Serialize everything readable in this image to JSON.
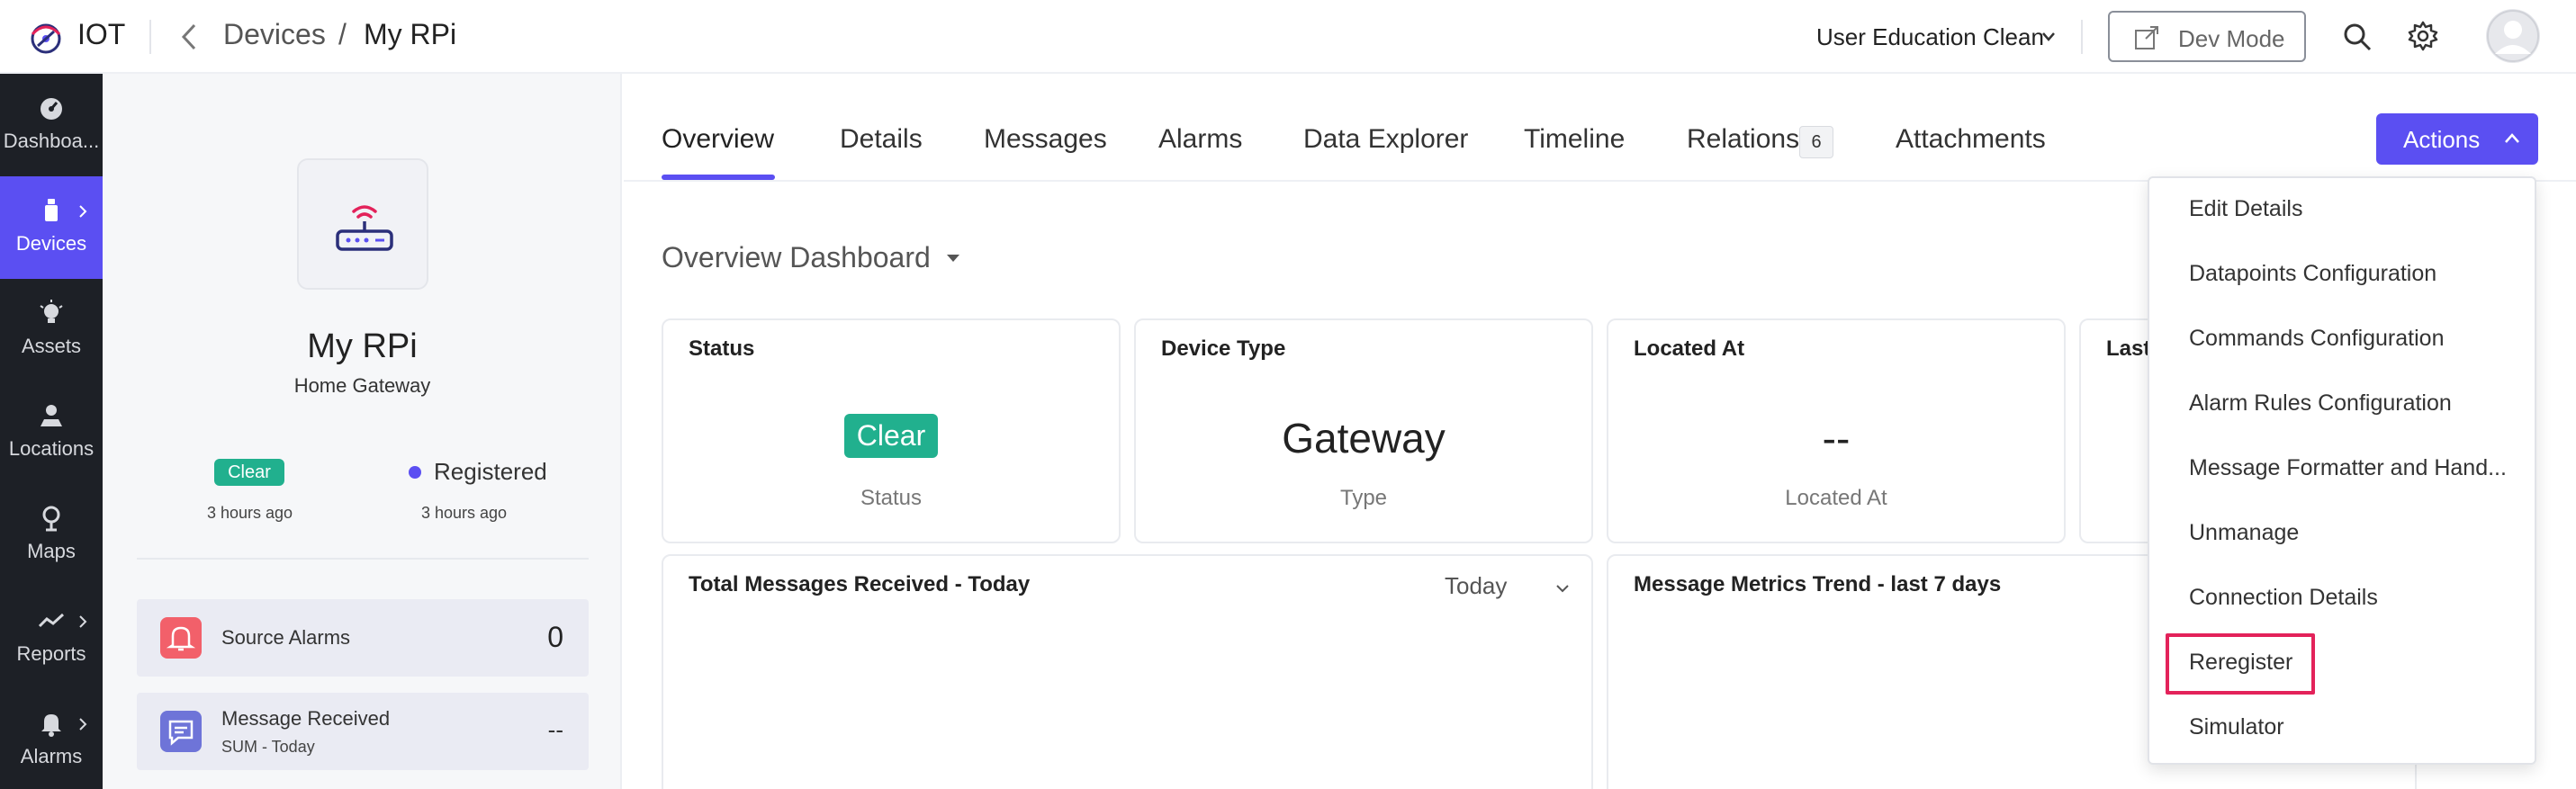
{
  "header": {
    "app_name": "IOT",
    "breadcrumb": {
      "parent": "Devices",
      "separator": "/",
      "current": "My RPi"
    },
    "org_name": "User Education Clean",
    "dev_mode_label": "Dev Mode"
  },
  "sidebar": {
    "items": [
      {
        "label": "Dashboa...",
        "icon": "dashboard-icon"
      },
      {
        "label": "Devices",
        "icon": "devices-icon",
        "active": true
      },
      {
        "label": "Assets",
        "icon": "assets-icon"
      },
      {
        "label": "Locations",
        "icon": "locations-icon"
      },
      {
        "label": "Maps",
        "icon": "maps-icon"
      },
      {
        "label": "Reports",
        "icon": "reports-icon"
      },
      {
        "label": "Alarms",
        "icon": "alarms-icon"
      }
    ]
  },
  "device": {
    "name": "My RPi",
    "type": "Home Gateway",
    "status_badge": "Clear",
    "status_time": "3 hours ago",
    "registration": "Registered",
    "registration_time": "3 hours ago",
    "metrics": [
      {
        "label": "Source Alarms",
        "value": "0"
      },
      {
        "label": "Message Received",
        "sub": "SUM - Today",
        "value": "--"
      }
    ]
  },
  "tabs": [
    {
      "label": "Overview",
      "active": true
    },
    {
      "label": "Details"
    },
    {
      "label": "Messages"
    },
    {
      "label": "Alarms"
    },
    {
      "label": "Data Explorer"
    },
    {
      "label": "Timeline"
    },
    {
      "label": "Relations",
      "count": "6"
    },
    {
      "label": "Attachments"
    }
  ],
  "actions_label": "Actions",
  "dashboard": {
    "title": "Overview Dashboard",
    "cards": [
      {
        "title": "Status",
        "value": "Clear",
        "caption": "Status"
      },
      {
        "title": "Device Type",
        "value": "Gateway",
        "caption": "Type"
      },
      {
        "title": "Located At",
        "value": "--",
        "caption": "Located At"
      },
      {
        "title": "Last"
      }
    ],
    "charts": [
      {
        "title": "Total Messages Received - Today",
        "range": "Today"
      },
      {
        "title": "Message Metrics Trend - last 7 days"
      }
    ]
  },
  "actions_menu": [
    "Edit Details",
    "Datapoints Configuration",
    "Commands Configuration",
    "Alarm Rules Configuration",
    "Message Formatter and Hand...",
    "Unmanage",
    "Connection Details",
    "Reregister",
    "Simulator"
  ],
  "colors": {
    "accent": "#5b4ff2",
    "status_clear": "#21b08e",
    "sidebar_bg": "#1d2026",
    "highlight": "#e3225a"
  }
}
